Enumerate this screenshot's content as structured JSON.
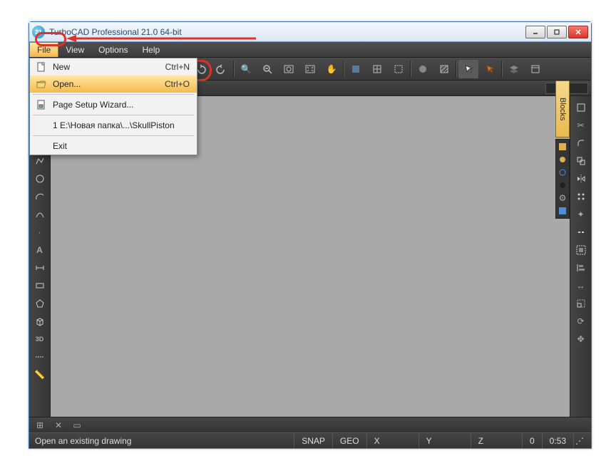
{
  "window": {
    "title": "TurboCAD Professional 21.0 64-bit"
  },
  "menubar": {
    "file": "File",
    "view": "View",
    "options": "Options",
    "help": "Help"
  },
  "file_menu": {
    "new_label": "New",
    "new_shortcut": "Ctrl+N",
    "open_label": "Open...",
    "open_shortcut": "Ctrl+O",
    "page_setup_label": "Page Setup Wizard...",
    "recent1_label": "1 E:\\Новая папка\\...\\SkullPiston",
    "exit_label": "Exit"
  },
  "blocks_panel": {
    "title": "Blocks"
  },
  "statusbar": {
    "hint": "Open an existing drawing",
    "snap": "SNAP",
    "geo": "GEO",
    "x_label": "X",
    "y_label": "Y",
    "z_label": "Z",
    "page": "0",
    "time": "0:53"
  }
}
